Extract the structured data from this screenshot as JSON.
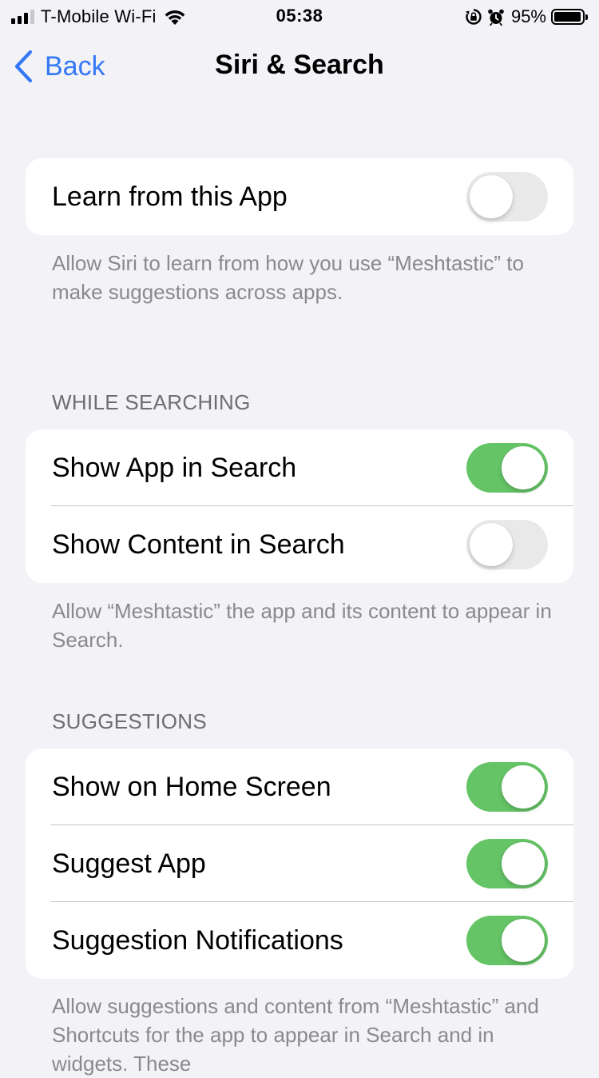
{
  "status_bar": {
    "carrier": "T-Mobile Wi-Fi",
    "time": "05:38",
    "battery_percent": "95%",
    "battery_level": 0.95,
    "signal_bars_filled": 3,
    "signal_bars_total": 4,
    "icons": [
      "signal-bars-icon",
      "wifi-icon",
      "orientation-lock-icon",
      "alarm-icon",
      "battery-icon"
    ]
  },
  "nav": {
    "back_label": "Back",
    "title": "Siri & Search",
    "accent_color": "#3478f6"
  },
  "learn_group": {
    "rows": [
      {
        "label": "Learn from this App",
        "enabled": false
      }
    ],
    "footer": "Allow Siri to learn from how you use “Meshtastic” to make suggestions across apps."
  },
  "searching_group": {
    "header": "WHILE SEARCHING",
    "rows": [
      {
        "label": "Show App in Search",
        "enabled": true
      },
      {
        "label": "Show Content in Search",
        "enabled": false
      }
    ],
    "footer": "Allow “Meshtastic” the app and its content to appear in Search."
  },
  "suggestions_group": {
    "header": "SUGGESTIONS",
    "rows": [
      {
        "label": "Show on Home Screen",
        "enabled": true
      },
      {
        "label": "Suggest App",
        "enabled": true
      },
      {
        "label": "Suggestion Notifications",
        "enabled": true
      }
    ],
    "footer": "Allow suggestions and content from “Meshtastic” and Shortcuts for the app to appear in Search and in widgets. These"
  },
  "colors": {
    "toggle_on": "#65c466",
    "toggle_off": "#e9e9ea",
    "background": "#f2f2f7"
  }
}
